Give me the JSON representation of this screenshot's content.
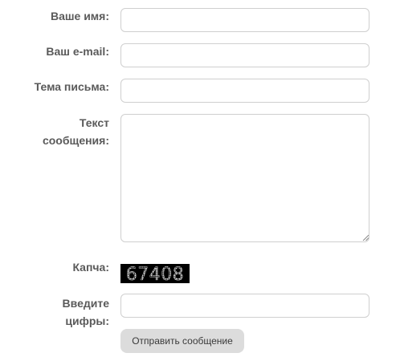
{
  "form": {
    "name_label": "Ваше имя:",
    "name_value": "",
    "email_label": "Ваш e-mail:",
    "email_value": "",
    "subject_label": "Тема письма:",
    "subject_value": "",
    "message_label_line1": "Текст",
    "message_label_line2": "сообщения:",
    "message_value": "",
    "captcha_label": "Капча:",
    "captcha_code": "67408",
    "digits_label_line1": "Введите",
    "digits_label_line2": "цифры:",
    "digits_value": "",
    "submit_label": "Отправить сообщение"
  },
  "colors": {
    "label_text": "#5a5a5a",
    "field_border": "#cfcfcf",
    "button_bg": "#dcdcdc",
    "captcha_bg": "#000000"
  }
}
